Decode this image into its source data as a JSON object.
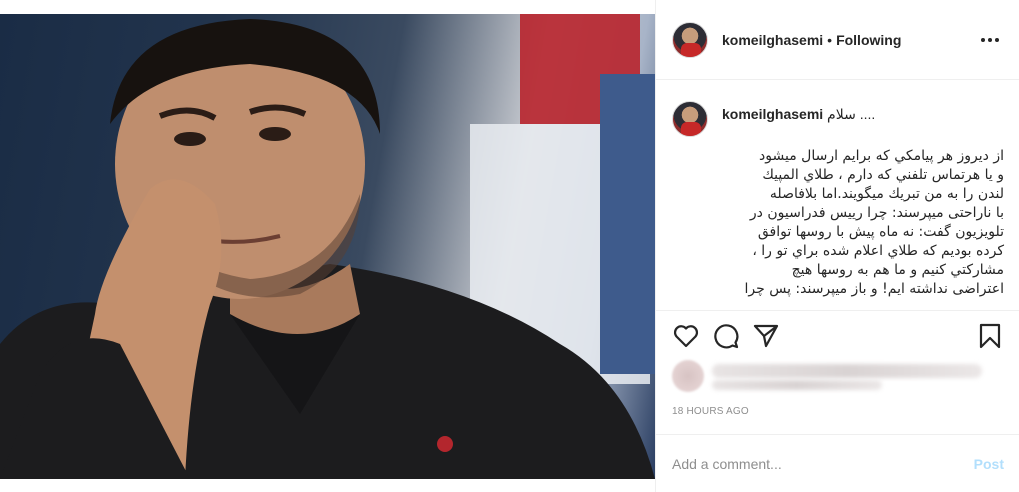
{
  "post": {
    "author": {
      "username": "komeilghasemi",
      "follow_status": "Following",
      "separator": "•"
    },
    "caption": {
      "username": "komeilghasemi",
      "first_line": "سلام ....",
      "lines": [
        "از ديروز هر پيامكي كه برايم ارسال ميشود",
        "و يا هرتماس تلفني كه دارم ، طلاي المپيك",
        "لندن را به من تبريك ميگويند.اما بلافاصله",
        "با ناراحتی ميپرسند: چرا رييس فدراسيون در",
        "تلويزيون گفت: نه ماه پيش با روسها توافق",
        "كرده بوديم كه طلاي اعلام شده براي تو را ،",
        "مشاركتي كنيم و ما هم به روسها هيچ",
        "اعتراضی نداشته ایم! و باز ميپرسند: پس چرا"
      ]
    },
    "actions": {
      "like_icon": "heart-icon",
      "comment_icon": "comment-bubble-icon",
      "share_icon": "paper-plane-icon",
      "save_icon": "bookmark-icon"
    },
    "timestamp": "18 HOURS AGO",
    "comment_input": {
      "placeholder": "Add a comment...",
      "post_label": "Post"
    }
  },
  "colors": {
    "text": "#262626",
    "muted": "#8e8e8e",
    "border": "#efefef",
    "post_button_disabled": "#b2dffc"
  }
}
